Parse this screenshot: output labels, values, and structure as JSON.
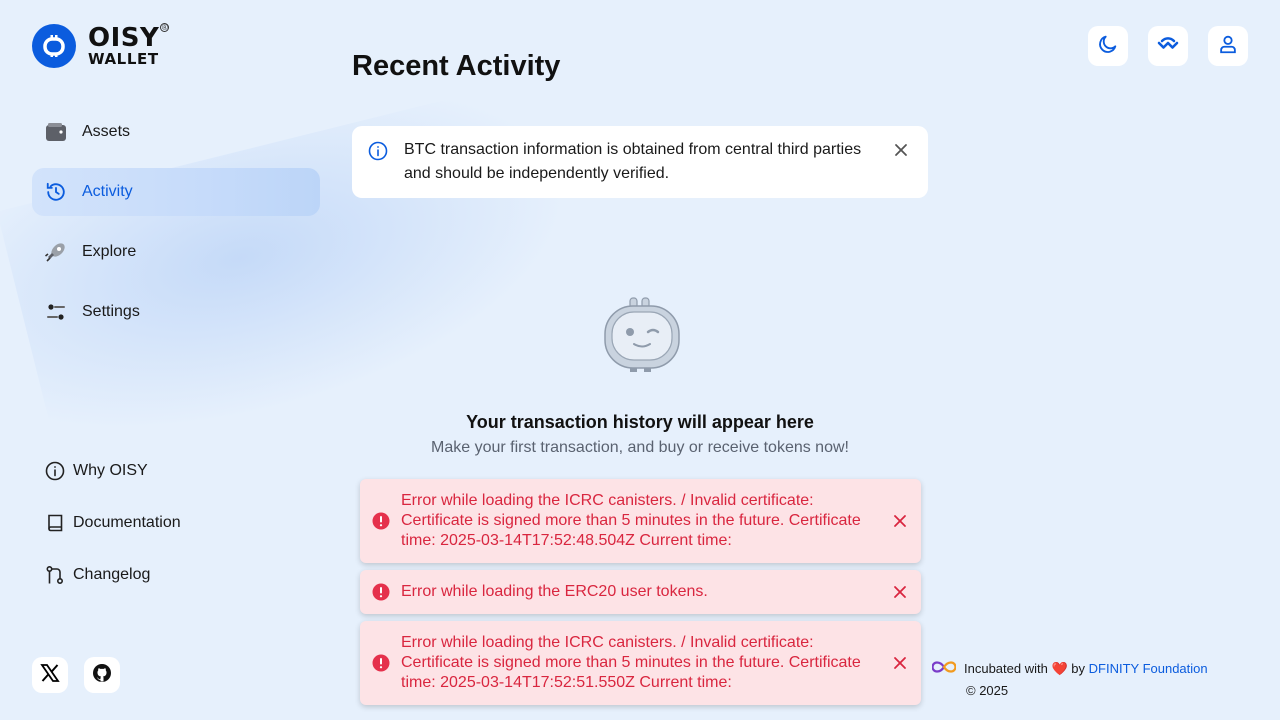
{
  "brand": {
    "line1": "OISY",
    "line2": "WALLET",
    "reg": "®"
  },
  "nav": {
    "items": [
      {
        "label": "Assets",
        "icon": "wallet-icon"
      },
      {
        "label": "Activity",
        "icon": "history-icon",
        "active": true
      },
      {
        "label": "Explore",
        "icon": "rocket-icon"
      },
      {
        "label": "Settings",
        "icon": "sliders-icon"
      }
    ]
  },
  "secondary_nav": {
    "items": [
      {
        "label": "Why OISY",
        "icon": "info-circle-icon"
      },
      {
        "label": "Documentation",
        "icon": "book-icon"
      },
      {
        "label": "Changelog",
        "icon": "git-branch-icon"
      }
    ]
  },
  "header": {
    "buttons": [
      "moon-icon",
      "walletconnect-icon",
      "user-icon"
    ]
  },
  "main": {
    "title": "Recent Activity",
    "info_banner": "BTC transaction information is obtained from central third parties and should be independently verified.",
    "empty_title": "Your transaction history will appear here",
    "empty_subtitle": "Make your first transaction, and buy or receive tokens now!"
  },
  "toasts": [
    {
      "message": "Error while loading the ICRC canisters. / Invalid certificate: Certificate is signed more than 5 minutes in the future. Certificate time: 2025-03-14T17:52:48.504Z Current time:"
    },
    {
      "message": "Error while loading the ERC20 user tokens."
    },
    {
      "message": "Error while loading the ICRC canisters. / Invalid certificate: Certificate is signed more than 5 minutes in the future. Certificate time: 2025-03-14T17:52:51.550Z Current time:"
    }
  ],
  "footer": {
    "incubated_prefix": "Incubated with",
    "heart": "❤️",
    "by": "by",
    "foundation": "DFINITY Foundation",
    "copyright": "© 2025"
  },
  "colors": {
    "accent": "#0b5cde",
    "error": "#d9263f",
    "background": "#e6f0fc"
  }
}
